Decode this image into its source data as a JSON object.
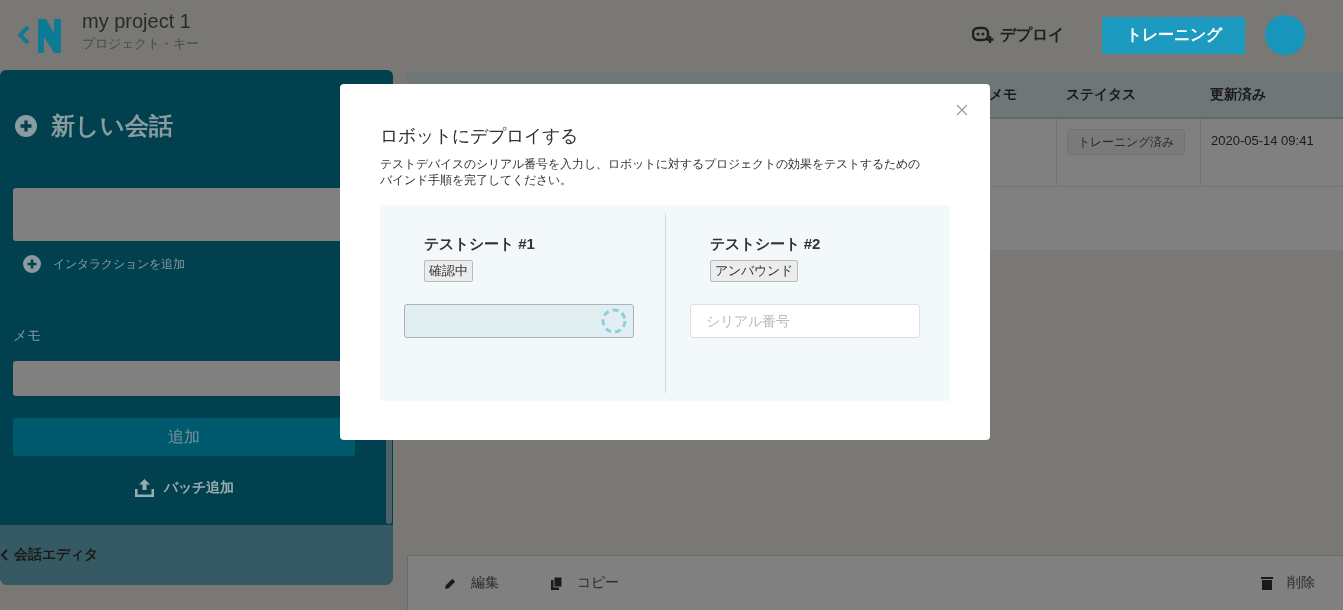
{
  "header": {
    "project_title": "my project 1",
    "project_key_label": "プロジェクト・キー",
    "deploy_button": "デプロイ",
    "training_button": "トレーニング"
  },
  "sidebar": {
    "title": "新しい会話",
    "add_interaction": "インタラクションを追加",
    "memo_label": "メモ",
    "add_button": "追加",
    "batch_add": "バッチ追加",
    "editor_tab": "会話エディタ"
  },
  "table": {
    "columns": [
      "メモ",
      "ステイタス",
      "更新済み"
    ],
    "rows": [
      {
        "status": "トレーニング済み",
        "updated": "2020-05-14 09:41"
      }
    ]
  },
  "toolbar": {
    "left": [
      {
        "kind": "edit",
        "label": "編集"
      },
      {
        "kind": "copy",
        "label": "コピー"
      }
    ],
    "right": [
      {
        "kind": "delete",
        "label": "削除"
      }
    ]
  },
  "modal": {
    "title": "ロボットにデプロイする",
    "description": "テストデバイスのシリアル番号を入力し、ロボットに対するプロジェクトの効果をテストするためのバインド手順を完了してください。",
    "seats": [
      {
        "name": "テストシート #1",
        "status": "確認中",
        "loading": true
      },
      {
        "name": "テストシート #2",
        "status": "アンバウンド",
        "loading": false,
        "placeholder": "シリアル番号"
      }
    ]
  }
}
